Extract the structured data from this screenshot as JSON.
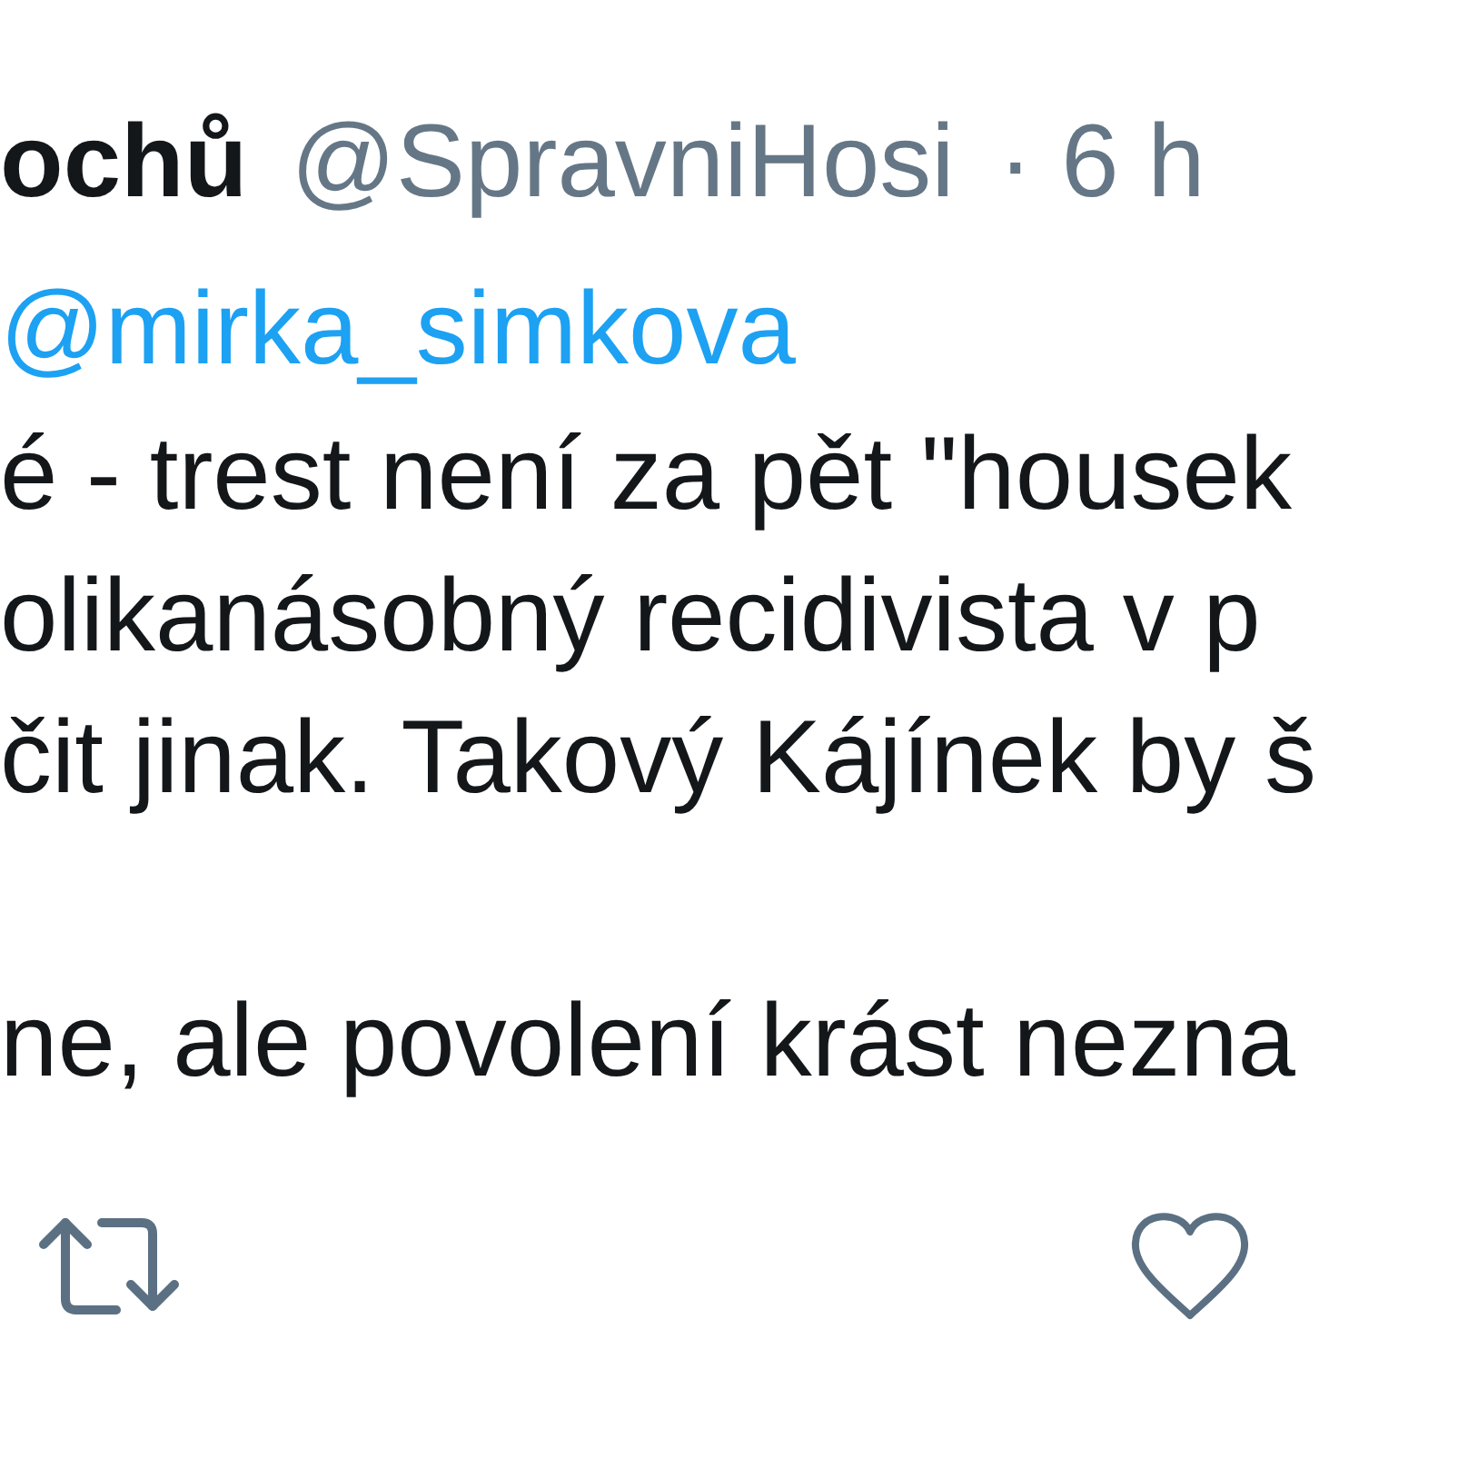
{
  "tweet": {
    "author_name": "ochů",
    "handle": "@SpravniHosi",
    "time": "· 6 h",
    "reply_to": "@mirka_simkova",
    "paragraphs": [
      [
        "é - trest není za pět \"housek",
        "olikanásobný recidivista v p",
        "čit jinak. Takový Kájínek by š"
      ],
      [
        "ne, ale povolení krást nezna"
      ]
    ]
  },
  "actions": [
    {
      "kind": "retweet"
    },
    {
      "kind": "like"
    }
  ]
}
